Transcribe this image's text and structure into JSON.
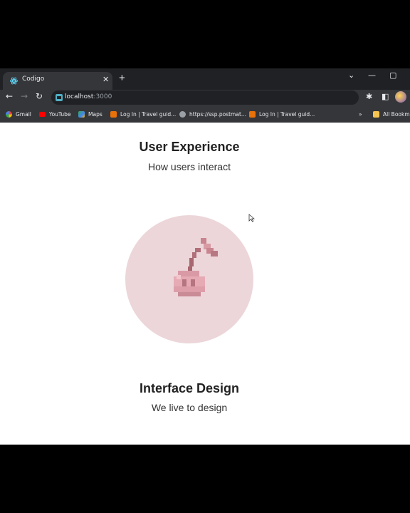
{
  "browser": {
    "tab_title": "Codigo",
    "url_host": "localhost",
    "url_port": ":3000",
    "bookmarks": [
      {
        "label": "Gmail",
        "icon": "gmail-icon"
      },
      {
        "label": "YouTube",
        "icon": "youtube-icon"
      },
      {
        "label": "Maps",
        "icon": "maps-icon"
      },
      {
        "label": "Log In | Travel guid...",
        "icon": "travel-icon"
      },
      {
        "label": "https://ssp.postmat...",
        "icon": "globe-icon"
      },
      {
        "label": "Log In | Travel guid...",
        "icon": "travel-icon"
      },
      {
        "label": "All Bookmarks",
        "icon": "folder-icon"
      }
    ],
    "more_bookmarks_glyph": "»"
  },
  "sections": [
    {
      "title": "User Experience",
      "subtitle": "How users interact"
    },
    {
      "title": "Interface Design",
      "subtitle": "We live to design"
    }
  ],
  "illustration": {
    "icon": "cherry-pixel-icon",
    "circle_color": "#ecd6d9"
  },
  "colors": {
    "tab_bar": "#1f2124",
    "toolbar": "#35363a",
    "omnibox": "#202124",
    "page_bg": "#ffffff"
  }
}
